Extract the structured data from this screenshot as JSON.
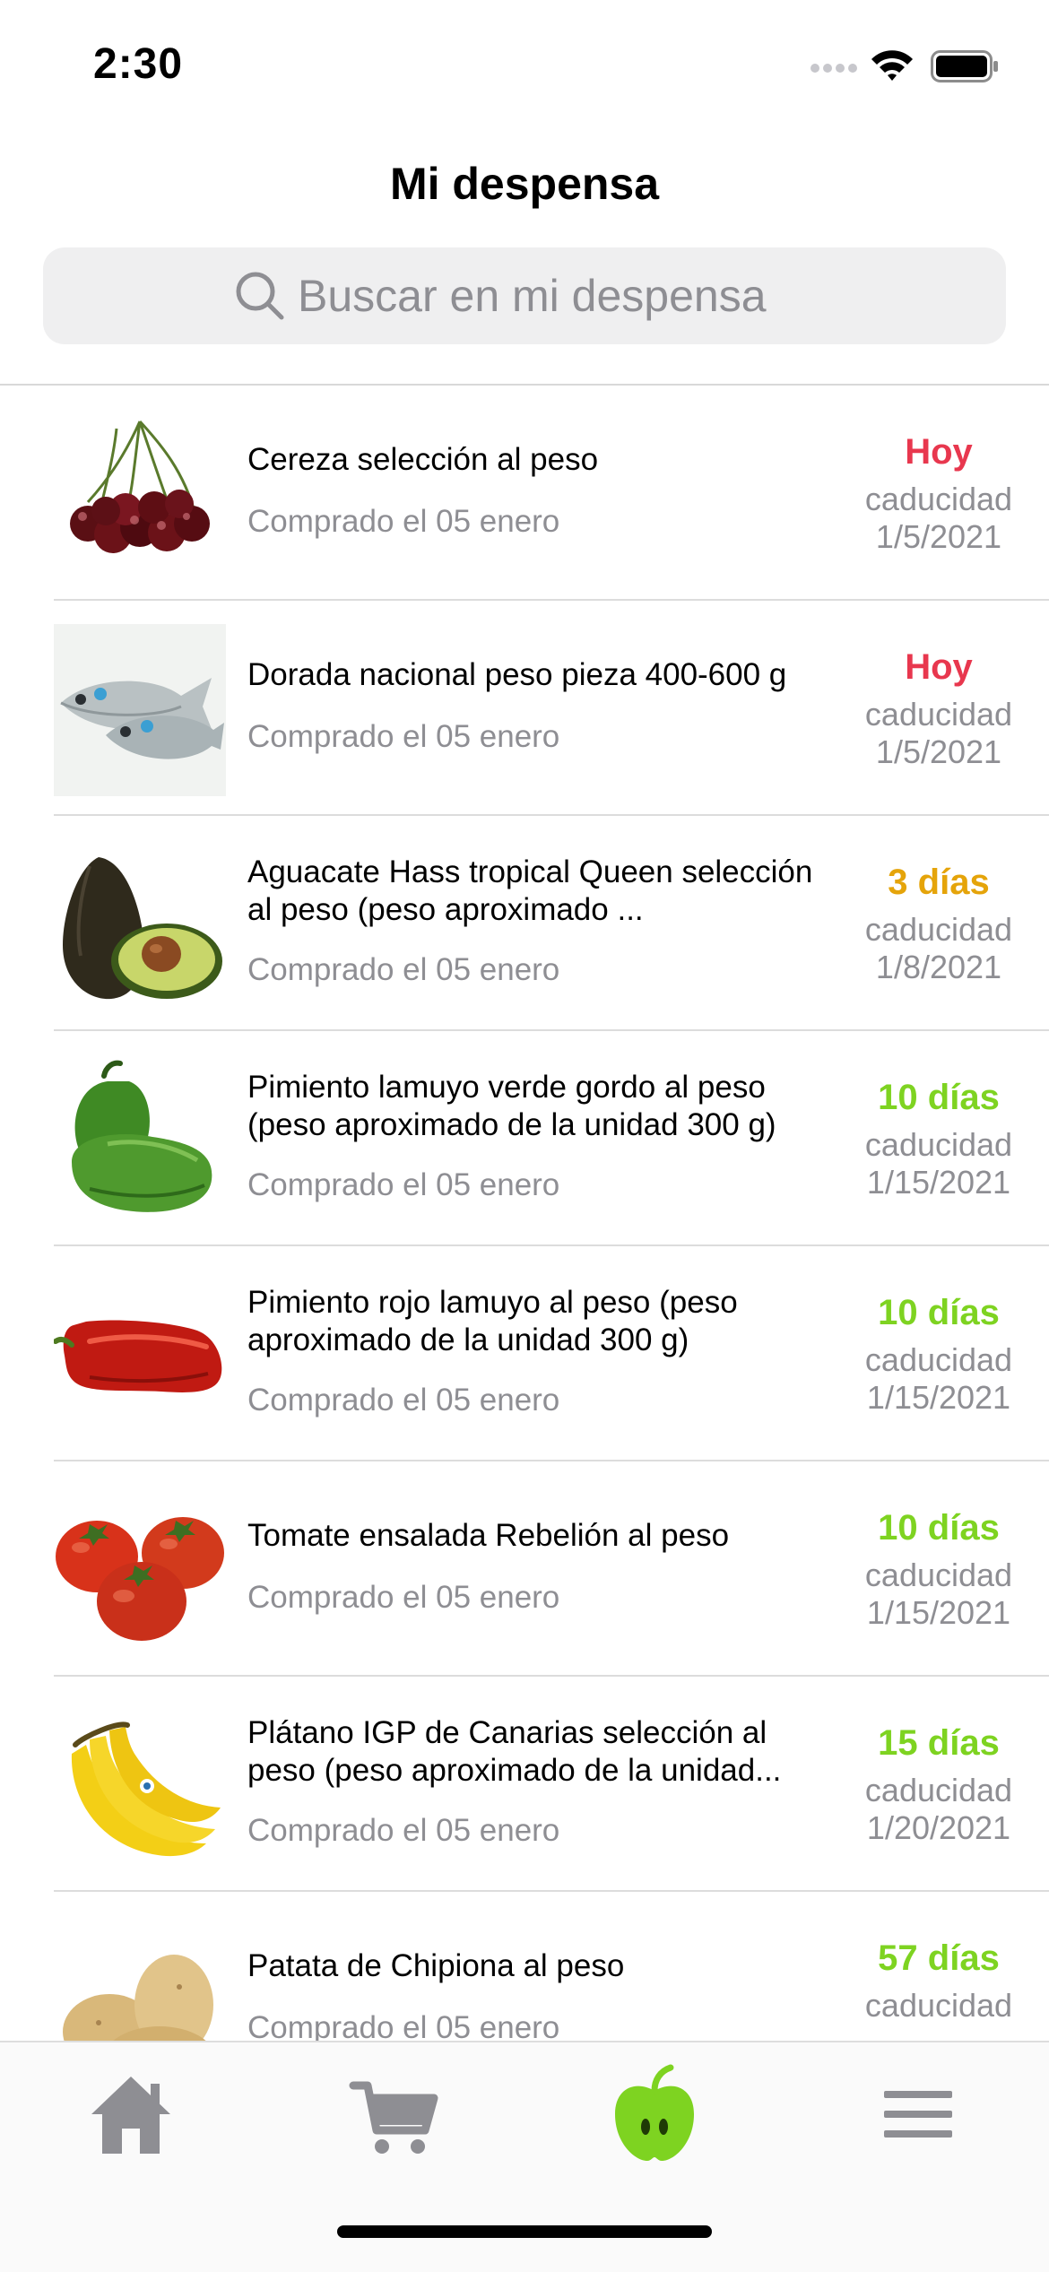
{
  "status": {
    "time": "2:30"
  },
  "header": {
    "title": "Mi despensa"
  },
  "search": {
    "placeholder": "Buscar en mi despensa"
  },
  "colors": {
    "today": "#e8374e",
    "soon": "#e5a40a",
    "ok": "#7ed321",
    "tab_active": "#7ed321",
    "tab_inactive": "#8e8e93"
  },
  "items": [
    {
      "name": "Cereza selección al peso",
      "bought": "Comprado el 05 enero",
      "days": "Hoy",
      "exp_label": "caducidad",
      "exp_date": "1/5/2021",
      "status": "today",
      "image_icon": "cherries-image"
    },
    {
      "name": "Dorada nacional peso pieza 400-600 g",
      "bought": "Comprado el 05 enero",
      "days": "Hoy",
      "exp_label": "caducidad",
      "exp_date": "1/5/2021",
      "status": "today",
      "image_icon": "fish-image"
    },
    {
      "name": "Aguacate Hass tropical Queen selección al peso (peso aproximado ...",
      "bought": "Comprado el 05 enero",
      "days": "3 días",
      "exp_label": "caducidad",
      "exp_date": "1/8/2021",
      "status": "soon",
      "image_icon": "avocado-image"
    },
    {
      "name": "Pimiento lamuyo verde gordo al peso (peso aproximado de la unidad 300 g)",
      "bought": "Comprado el 05 enero",
      "days": "10 días",
      "exp_label": "caducidad",
      "exp_date": "1/15/2021",
      "status": "ok",
      "image_icon": "green-pepper-image"
    },
    {
      "name": "Pimiento rojo lamuyo al peso (peso aproximado de la unidad 300 g)",
      "bought": "Comprado el 05 enero",
      "days": "10 días",
      "exp_label": "caducidad",
      "exp_date": "1/15/2021",
      "status": "ok",
      "image_icon": "red-pepper-image"
    },
    {
      "name": "Tomate ensalada Rebelión al peso",
      "bought": "Comprado el 05 enero",
      "days": "10 días",
      "exp_label": "caducidad",
      "exp_date": "1/15/2021",
      "status": "ok",
      "image_icon": "tomatoes-image"
    },
    {
      "name": "Plátano IGP de Canarias selección al peso (peso aproximado de la unidad...",
      "bought": "Comprado el 05 enero",
      "days": "15 días",
      "exp_label": "caducidad",
      "exp_date": "1/20/2021",
      "status": "ok",
      "image_icon": "bananas-image"
    },
    {
      "name": "Patata de Chipiona al peso",
      "bought": "Comprado el 05 enero",
      "days": "57 días",
      "exp_label": "caducidad",
      "exp_date": "",
      "status": "ok",
      "image_icon": "potatoes-image"
    }
  ],
  "tabs": [
    {
      "icon": "home-icon",
      "active": false
    },
    {
      "icon": "cart-icon",
      "active": false
    },
    {
      "icon": "apple-icon",
      "active": true
    },
    {
      "icon": "menu-icon",
      "active": false
    }
  ]
}
